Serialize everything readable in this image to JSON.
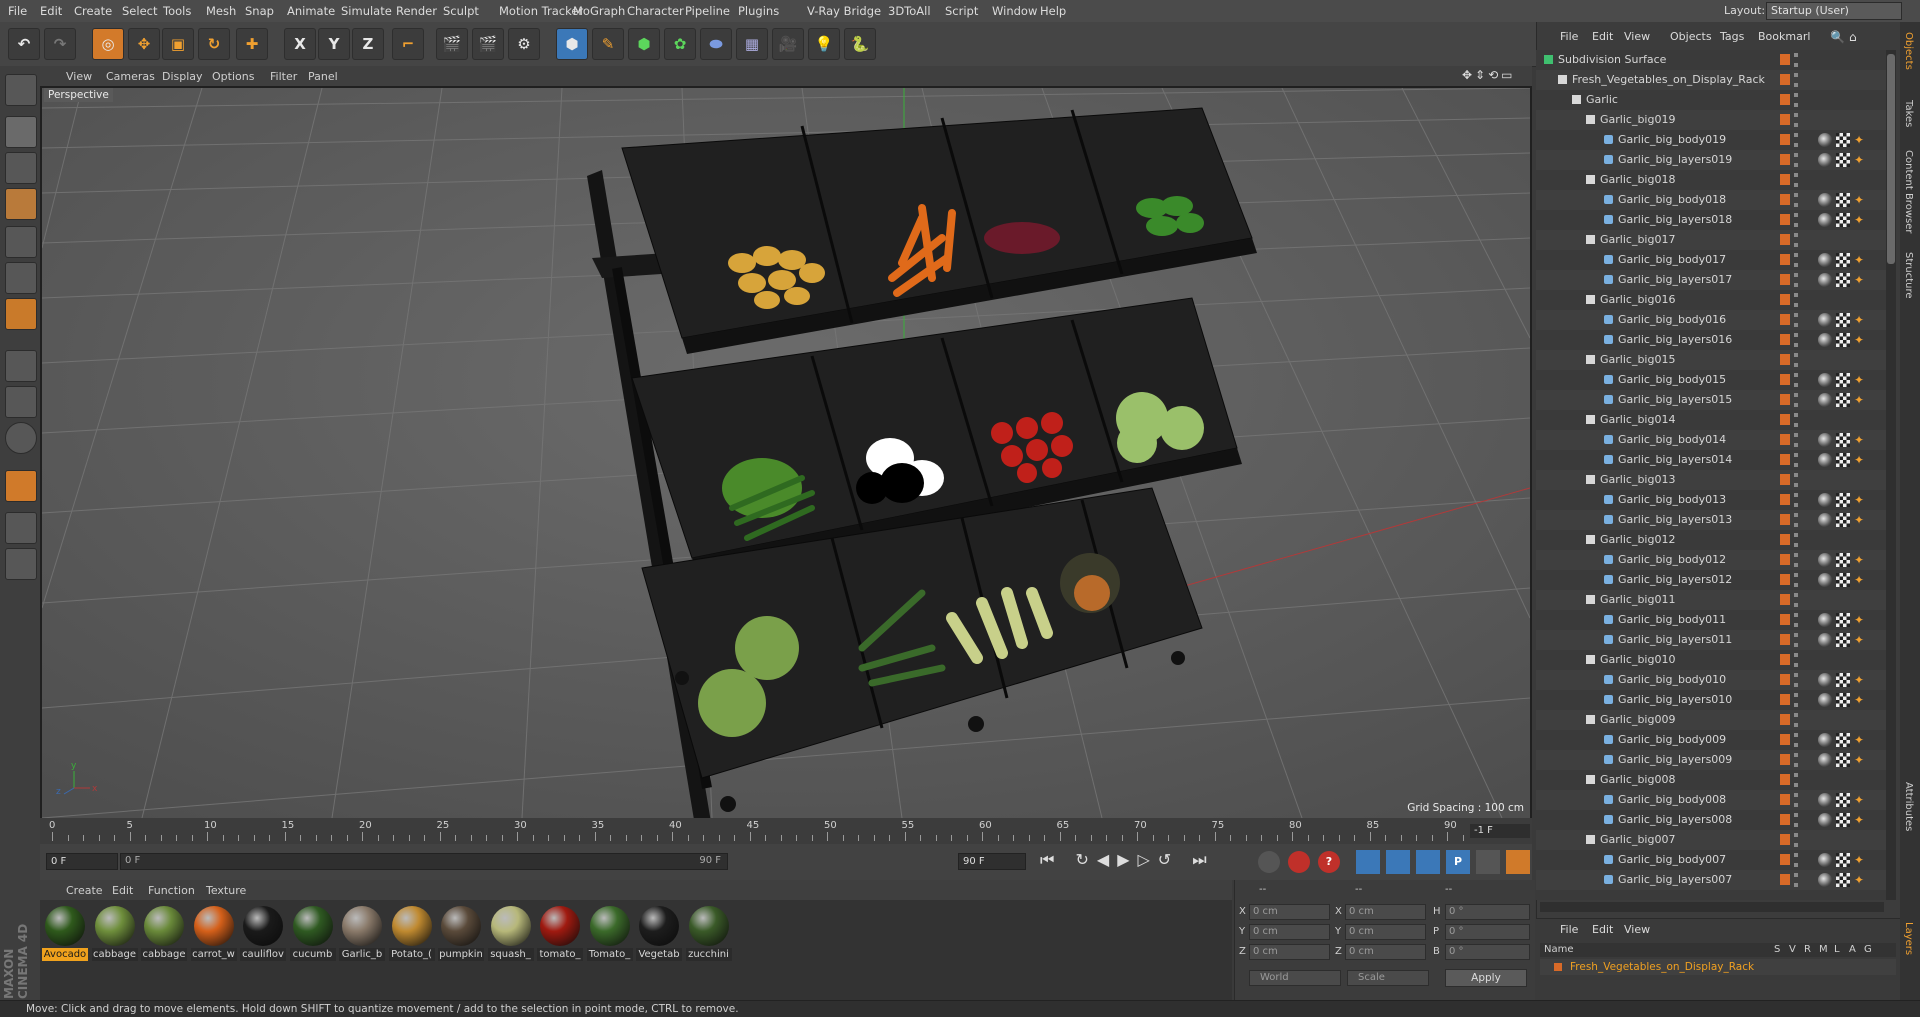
{
  "menu": [
    "File",
    "Edit",
    "Create",
    "Select",
    "Tools",
    "Mesh",
    "Snap",
    "Animate",
    "Simulate",
    "Render",
    "Sculpt",
    "Motion Tracker",
    "MoGraph",
    "Character",
    "Pipeline",
    "Plugins",
    "V-Ray Bridge",
    "3DToAll",
    "Script",
    "Window",
    "Help"
  ],
  "layout": {
    "label": "Layout:",
    "value": "Startup (User)"
  },
  "toolbar": {
    "x": "X",
    "y": "Y",
    "z": "Z"
  },
  "viewport": {
    "menu": [
      "View",
      "Cameras",
      "Display",
      "Options",
      "Filter",
      "Panel"
    ],
    "camera": "Perspective",
    "grid_spacing": "Grid Spacing : 100 cm"
  },
  "timeline": {
    "ticks": [
      "0",
      "5",
      "10",
      "15",
      "20",
      "25",
      "30",
      "35",
      "40",
      "45",
      "50",
      "55",
      "60",
      "65",
      "70",
      "75",
      "80",
      "85",
      "90"
    ],
    "current": "-1 F",
    "start_field": "0 F",
    "scrub_start": "0 F",
    "scrub_end": "90 F",
    "end_field": "90 F"
  },
  "materials": {
    "menu": [
      "Create",
      "Edit",
      "Function",
      "Texture"
    ],
    "items": [
      {
        "label": "Avocado",
        "color": "#2f5a1c"
      },
      {
        "label": "cabbage",
        "color": "#6f8f3c"
      },
      {
        "label": "cabbage",
        "color": "#6a8a3a"
      },
      {
        "label": "carrot_w",
        "color": "#d5601a"
      },
      {
        "label": "cauliflov",
        "color": "#1a1a1a"
      },
      {
        "label": "cucumb",
        "color": "#2f5a22"
      },
      {
        "label": "Garlic_b",
        "color": "#8a7a6a"
      },
      {
        "label": "Potato_(",
        "color": "#c08a30"
      },
      {
        "label": "pumpkin",
        "color": "#5a4a3a"
      },
      {
        "label": "squash_",
        "color": "#b7b87a"
      },
      {
        "label": "tomato_",
        "color": "#a01a10"
      },
      {
        "label": "Tomato_",
        "color": "#3b6a2a"
      },
      {
        "label": "Vegetab",
        "color": "#1d1d1d"
      },
      {
        "label": "zucchini",
        "color": "#3a5a28"
      }
    ]
  },
  "coords": {
    "header": [
      "--",
      "--",
      "--"
    ],
    "rows": [
      {
        "a": "X",
        "av": "0 cm",
        "b": "X",
        "bv": "0 cm",
        "c": "H",
        "cv": "0 °"
      },
      {
        "a": "Y",
        "av": "0 cm",
        "b": "Y",
        "bv": "0 cm",
        "c": "P",
        "cv": "0 °"
      },
      {
        "a": "Z",
        "av": "0 cm",
        "b": "Z",
        "bv": "0 cm",
        "c": "B",
        "cv": "0 °"
      }
    ],
    "world": "World",
    "scale": "Scale",
    "apply": "Apply"
  },
  "objects": {
    "menu": [
      "File",
      "Edit",
      "View",
      "Objects",
      "Tags",
      "Bookmarl"
    ],
    "root": "Subdivision Surface",
    "rack": "Fresh_Vegetables_on_Display_Rack",
    "group": "Garlic",
    "items": [
      {
        "name": "Garlic_big019",
        "body": "Garlic_big_body019",
        "layers": "Garlic_big_layers019"
      },
      {
        "name": "Garlic_big018",
        "body": "Garlic_big_body018",
        "layers": "Garlic_big_layers018"
      },
      {
        "name": "Garlic_big017",
        "body": "Garlic_big_body017",
        "layers": "Garlic_big_layers017"
      },
      {
        "name": "Garlic_big016",
        "body": "Garlic_big_body016",
        "layers": "Garlic_big_layers016"
      },
      {
        "name": "Garlic_big015",
        "body": "Garlic_big_body015",
        "layers": "Garlic_big_layers015"
      },
      {
        "name": "Garlic_big014",
        "body": "Garlic_big_body014",
        "layers": "Garlic_big_layers014"
      },
      {
        "name": "Garlic_big013",
        "body": "Garlic_big_body013",
        "layers": "Garlic_big_layers013"
      },
      {
        "name": "Garlic_big012",
        "body": "Garlic_big_body012",
        "layers": "Garlic_big_layers012"
      },
      {
        "name": "Garlic_big011",
        "body": "Garlic_big_body011",
        "layers": "Garlic_big_layers011"
      },
      {
        "name": "Garlic_big010",
        "body": "Garlic_big_body010",
        "layers": "Garlic_big_layers010"
      },
      {
        "name": "Garlic_big009",
        "body": "Garlic_big_body009",
        "layers": "Garlic_big_layers009"
      },
      {
        "name": "Garlic_big008",
        "body": "Garlic_big_body008",
        "layers": "Garlic_big_layers008"
      },
      {
        "name": "Garlic_big007",
        "body": "Garlic_big_body007",
        "layers": "Garlic_big_layers007"
      }
    ]
  },
  "vtabs": [
    "Objects",
    "Takes",
    "Content Browser",
    "Structure",
    "Attributes",
    "Layers"
  ],
  "layers": {
    "menu": [
      "File",
      "Edit",
      "View"
    ],
    "name_header": "Name",
    "cols": [
      "S",
      "V",
      "R",
      "M",
      "L",
      "A",
      "G"
    ],
    "layer": "Fresh_Vegetables_on_Display_Rack"
  },
  "maxon": "MAXON",
  "cinema": "CINEMA 4D",
  "status": "Move: Click and drag to move elements. Hold down SHIFT to quantize movement / add to the selection in point mode, CTRL to remove."
}
